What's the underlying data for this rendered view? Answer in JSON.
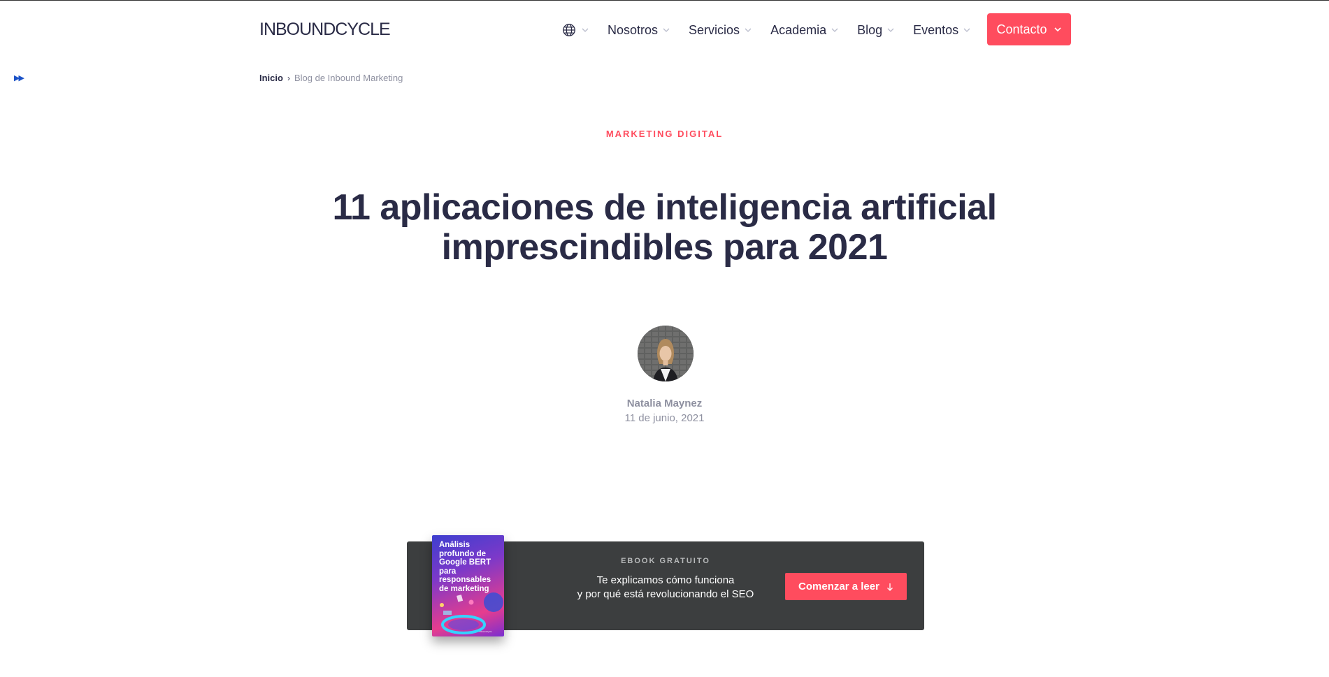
{
  "header": {
    "logo_text": "INBOUNDCYCLE",
    "nav": [
      {
        "label": "Nosotros"
      },
      {
        "label": "Servicios"
      },
      {
        "label": "Academia"
      },
      {
        "label": "Blog"
      },
      {
        "label": "Eventos"
      }
    ],
    "contact_label": "Contacto"
  },
  "breadcrumb": {
    "home": "Inicio",
    "current": "Blog de Inbound Marketing"
  },
  "article": {
    "category": "MARKETING DIGITAL",
    "title": "11 aplicaciones de inteligencia artificial imprescindibles para 2021",
    "author": "Natalia Maynez",
    "date": "11 de junio, 2021"
  },
  "ebook_banner": {
    "cover_title": "Análisis profundo de Google BERT para responsables de marketing",
    "label": "EBOOK GRATUITO",
    "text_line1": "Te explicamos cómo funciona",
    "text_line2": "y por qué está revolucionando el SEO",
    "button_label": "Comenzar a leer"
  },
  "colors": {
    "accent": "#ff4c5e",
    "text_dark": "#2a2b46",
    "banner_bg": "#3c3e3f",
    "muted": "#8e90a0"
  }
}
